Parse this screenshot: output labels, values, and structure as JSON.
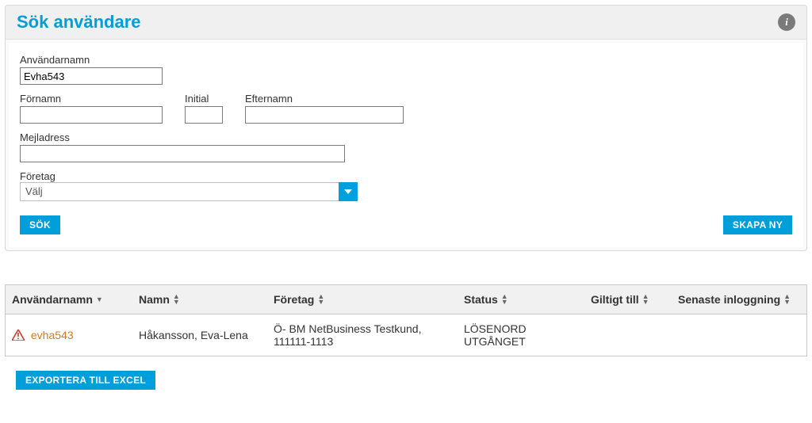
{
  "panel": {
    "title": "Sök användare"
  },
  "form": {
    "username": {
      "label": "Användarnamn",
      "value": "Evha543"
    },
    "fornamn": {
      "label": "Förnamn",
      "value": ""
    },
    "initial": {
      "label": "Initial",
      "value": ""
    },
    "efternamn": {
      "label": "Efternamn",
      "value": ""
    },
    "mejl": {
      "label": "Mejladress",
      "value": ""
    },
    "foretag": {
      "label": "Företag",
      "selected": "Välj"
    },
    "search_btn": "SÖK",
    "create_btn": "SKAPA NY"
  },
  "table": {
    "headers": {
      "username": "Användarnamn",
      "namn": "Namn",
      "foretag": "Företag",
      "status": "Status",
      "giltigt": "Giltigt till",
      "senaste": "Senaste inloggning"
    },
    "rows": [
      {
        "username": "evha543",
        "namn": "Håkansson, Eva-Lena",
        "foretag": "Ö- BM NetBusiness Testkund, 111111-1113",
        "status": "LÖSENORD UTGÅNGET",
        "giltigt": "",
        "senaste": ""
      }
    ]
  },
  "export_btn": "EXPORTERA TILL EXCEL"
}
